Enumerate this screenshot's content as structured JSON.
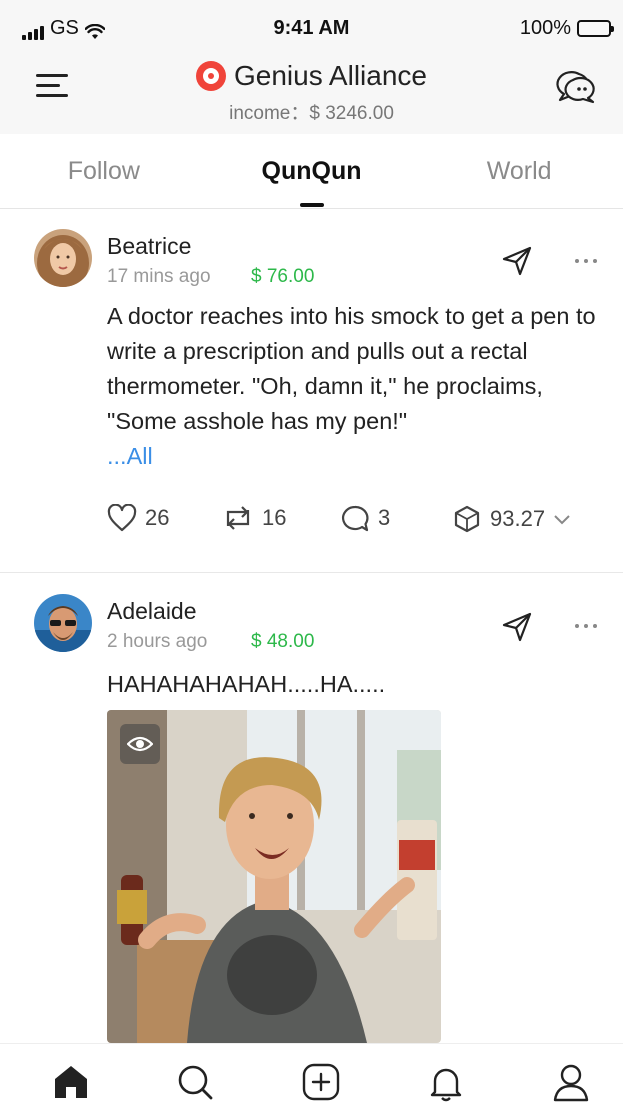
{
  "status_bar": {
    "carrier": "GS",
    "time": "9:41 AM",
    "battery": "100%"
  },
  "header": {
    "title": "Genius Alliance",
    "income": "income：$ 3246.00",
    "menu_icon": "hamburger-menu-icon",
    "chat_icon": "chat-bubbles-icon"
  },
  "tabs": [
    {
      "label": "Follow",
      "active": false
    },
    {
      "label": "QunQun",
      "active": true
    },
    {
      "label": "World",
      "active": false
    }
  ],
  "colors": {
    "brand_red": "#f0443a",
    "reward_green": "#2db84a",
    "link_blue": "#3a8ee6"
  },
  "posts": [
    {
      "author": "Beatrice",
      "time": "17 mins ago",
      "reward": "$ 76.00",
      "text": "A doctor reaches into his smock to get a pen to write a prescription and pulls out a rectal thermometer. \"Oh, damn it,\" he proclaims, \"Some asshole has my pen!\"",
      "more_link": "...All",
      "likes": "26",
      "reposts": "16",
      "comments": "3",
      "value": "93.27"
    },
    {
      "author": "Adelaide",
      "time": "2 hours ago",
      "reward": "$ 48.00",
      "text": "HAHAHAHAHAH.....HA....."
    }
  ],
  "tab_bar": [
    {
      "icon": "home-icon",
      "active": true
    },
    {
      "icon": "search-icon",
      "active": false
    },
    {
      "icon": "add-post-icon",
      "active": false
    },
    {
      "icon": "bell-icon",
      "active": false
    },
    {
      "icon": "profile-icon",
      "active": false
    }
  ]
}
